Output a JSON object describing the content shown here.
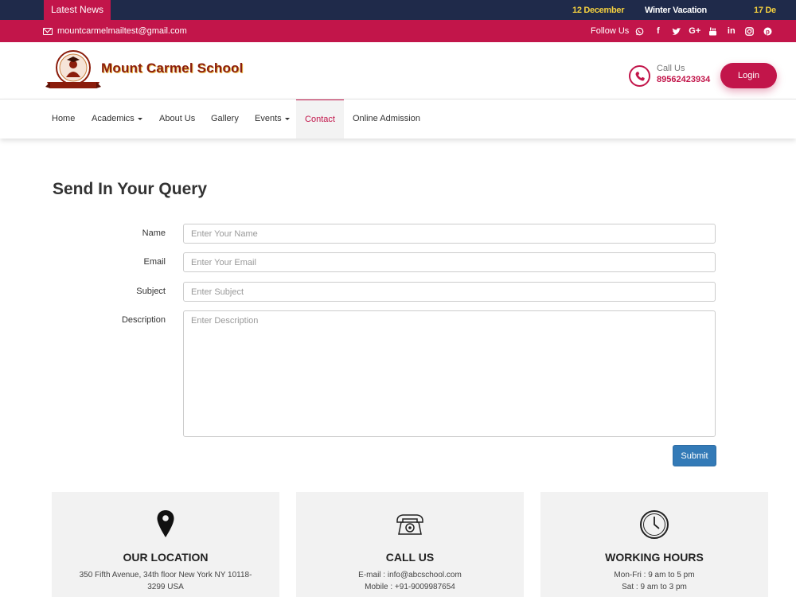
{
  "ticker": {
    "label": "Latest News",
    "items": [
      {
        "date": "12 December",
        "text": "Winter Vacation"
      },
      {
        "date": "17 De",
        "text": ""
      }
    ]
  },
  "topbar": {
    "email": "mountcarmelmailtest@gmail.com",
    "follow_label": "Follow Us",
    "socials": [
      "whatsapp-icon",
      "facebook-icon",
      "twitter-icon",
      "google-plus-icon",
      "youtube-icon",
      "linkedin-icon",
      "instagram-icon",
      "pinterest-icon"
    ]
  },
  "header": {
    "school_name": "Mount Carmel School",
    "call_label": "Call Us",
    "call_number": "89562423934",
    "login_label": "Login"
  },
  "nav": {
    "items": [
      "Home",
      "Academics",
      "About Us",
      "Gallery",
      "Events",
      "Contact",
      "Online Admission"
    ],
    "active": "Contact"
  },
  "form": {
    "title": "Send In Your Query",
    "name_label": "Name",
    "name_placeholder": "Enter Your Name",
    "email_label": "Email",
    "email_placeholder": "Enter Your Email",
    "subject_label": "Subject",
    "subject_placeholder": "Enter Subject",
    "description_label": "Description",
    "description_placeholder": "Enter Description",
    "submit_label": "Submit"
  },
  "cards": [
    {
      "title": "OUR LOCATION",
      "line1": "350 Fifth Avenue, 34th floor New York NY 10118-",
      "line2": "3299 USA",
      "icon": "map-pin-icon"
    },
    {
      "title": "CALL US",
      "line1": "E-mail : info@abcschool.com",
      "line2": "Mobile : +91-9009987654",
      "icon": "telephone-icon"
    },
    {
      "title": "WORKING HOURS",
      "line1": "Mon-Fri : 9 am to 5 pm",
      "line2": "Sat : 9 am to 3 pm",
      "icon": "clock-icon"
    }
  ],
  "colors": {
    "brand": "#c2154a",
    "ticker_bg": "#1f2a4a",
    "ticker_date": "#f4d03f",
    "submit": "#337ab7"
  }
}
